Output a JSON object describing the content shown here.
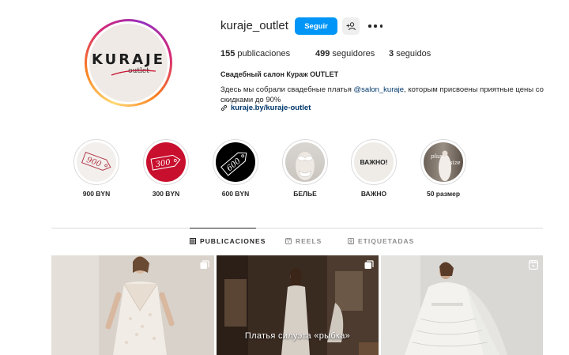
{
  "profile": {
    "username": "kuraje_outlet",
    "avatar_brand": "KURAJE",
    "avatar_sub": "outlet",
    "follow_label": "Seguir",
    "stats": {
      "posts_count": "155",
      "posts_label": "publicaciones",
      "followers_count": "499",
      "followers_label": "seguidores",
      "following_count": "3",
      "following_label": "seguidos"
    },
    "full_name": "Свадебный салон Кураж OUTLET",
    "bio_before": "Здесь мы собрали свадебные платья ",
    "bio_mention": "@salon_kuraje",
    "bio_after": ", которым присвоены приятные цены со скидками до 90%",
    "link": "kuraje.by/kuraje-outlet"
  },
  "highlights": [
    {
      "label": "900 BYN",
      "tag": "900"
    },
    {
      "label": "300 BYN",
      "tag": "300"
    },
    {
      "label": "600 BYN",
      "tag": "600"
    },
    {
      "label": "БЕЛЬЕ"
    },
    {
      "label": "ВАЖНО",
      "tag": "ВАЖНО!"
    },
    {
      "label": "50 размер",
      "tag_a": "plus",
      "tag_b": "size"
    }
  ],
  "tabs": {
    "posts": "PUBLICACIONES",
    "reels": "REELS",
    "tagged": "ETIQUETADAS"
  },
  "posts": [
    {
      "caption": ""
    },
    {
      "caption": "Платья силуэта «рыбка»"
    },
    {
      "caption": ""
    }
  ],
  "colors": {
    "accent": "#0095f6",
    "link": "#00376b",
    "highlight_red": "#c8102e",
    "highlight_black": "#000000"
  }
}
